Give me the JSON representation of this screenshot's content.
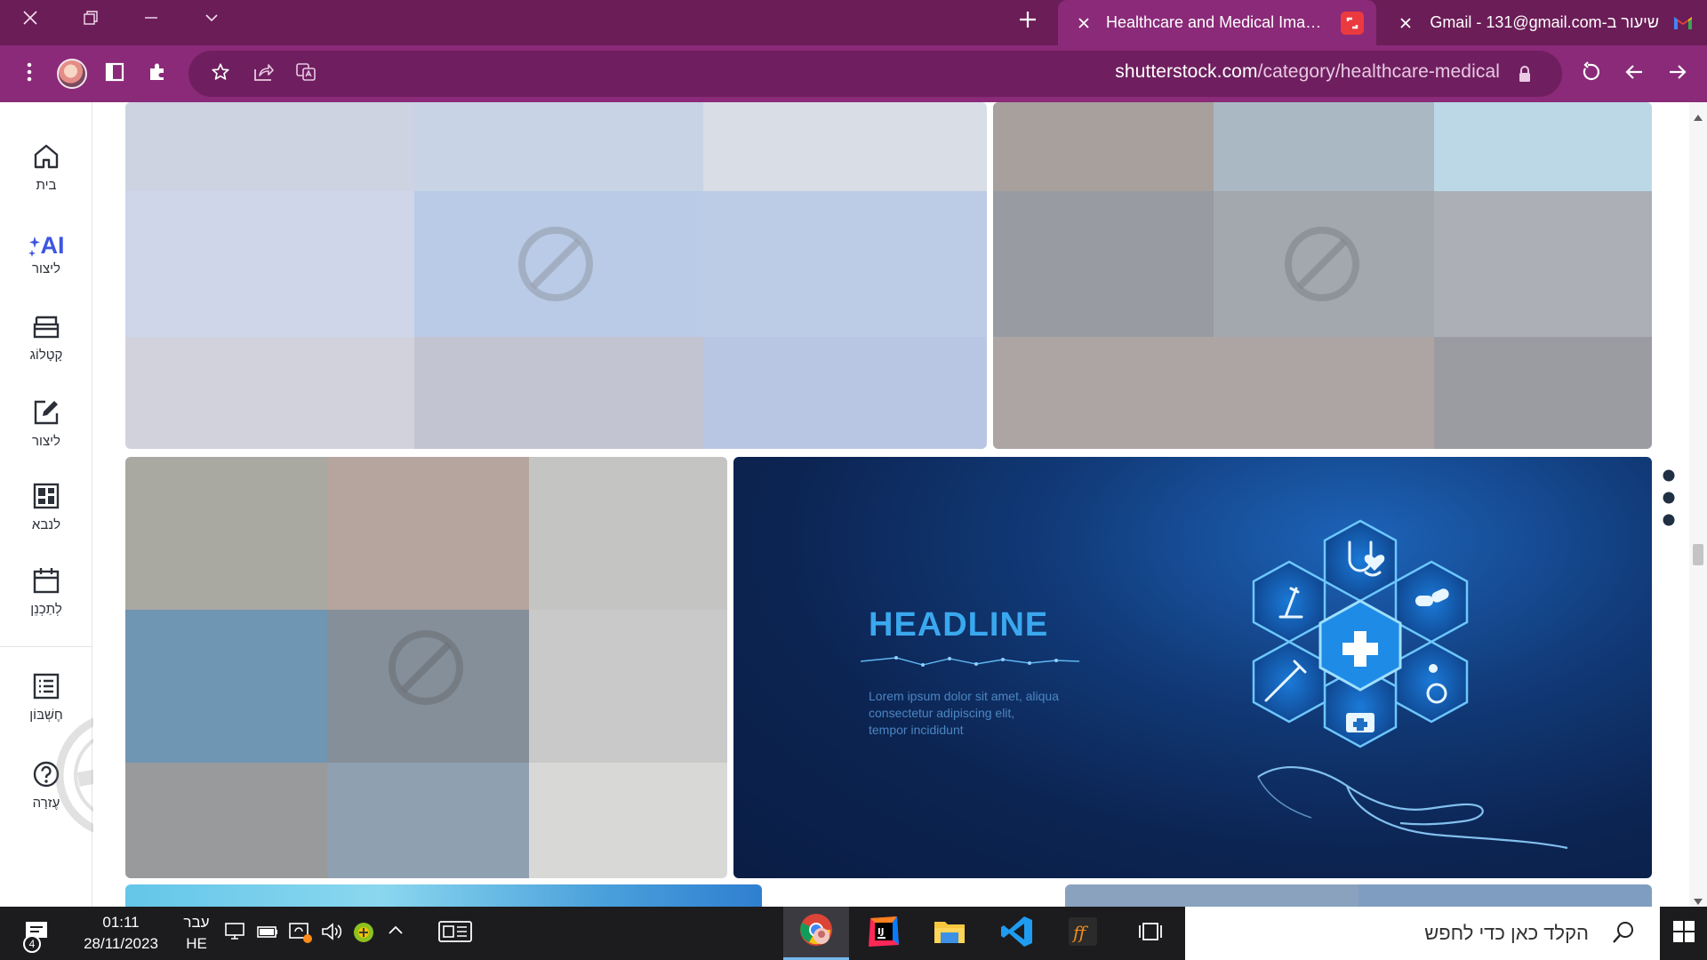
{
  "tabs": [
    {
      "title": "Healthcare and Medical Images,",
      "active": true,
      "favicon": "shutterstock-icon"
    },
    {
      "title": "שיעור ב-Gmail - 131@gmail.com",
      "active": false,
      "favicon": "gmail-icon"
    }
  ],
  "address_bar": {
    "host": "shutterstock.com",
    "path": "/category/healthcare-medical"
  },
  "left_nav": {
    "items": [
      {
        "label": "בית",
        "icon": "home-icon"
      },
      {
        "label": "ליצור",
        "icon": "ai-icon",
        "badge": "AI"
      },
      {
        "label": "קָטָלוֹג",
        "icon": "catalog-icon"
      },
      {
        "label": "ליצור",
        "icon": "edit-icon"
      },
      {
        "label": "לנבא",
        "icon": "predict-icon"
      },
      {
        "label": "לְתַכְנֵן",
        "icon": "calendar-icon"
      },
      {
        "label": "חֶשְׁבּוֹן",
        "icon": "account-list-icon"
      },
      {
        "label": "עֶזרָה",
        "icon": "help-icon"
      }
    ]
  },
  "featured_image": {
    "headline": "HEADLINE",
    "body": [
      "Lorem ipsum dolor sit amet, aliqua",
      "consectetur adipiscing elit,",
      "tempor incididunt"
    ]
  },
  "taskbar": {
    "notifications_count": "4",
    "time": "01:11",
    "date": "28/11/2023",
    "lang_top": "עבר",
    "lang_bottom": "HE",
    "search_placeholder": "הקלד כאן כדי לחפש"
  },
  "colors": {
    "titlebar": "#6b1d57",
    "toolbar": "#8a2a78",
    "featured_bg": "#0f2a55",
    "headline": "#3aa8ee"
  }
}
